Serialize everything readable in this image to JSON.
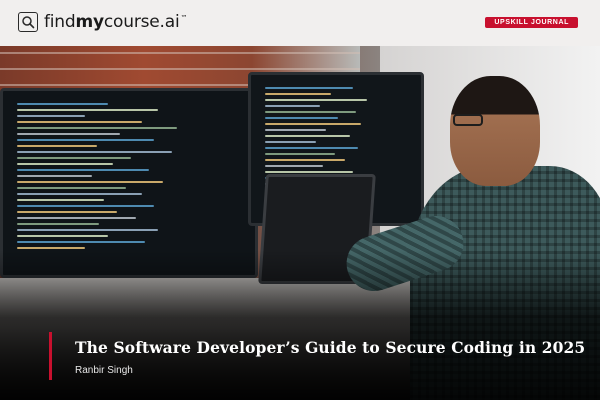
{
  "brand": {
    "logo_text_find": "find",
    "logo_text_my": "my",
    "logo_text_course": "course.ai",
    "trademark": "™",
    "icon": "search-icon"
  },
  "badge": {
    "label": "UPSKILL JOURNAL",
    "color": "#c8102e"
  },
  "hero": {
    "image": "developer-coding-at-desk",
    "accent_color": "#c8102e"
  },
  "article": {
    "title": "The Software Developer’s Guide to Secure Coding in 2025",
    "author": "Ranbir Singh"
  }
}
